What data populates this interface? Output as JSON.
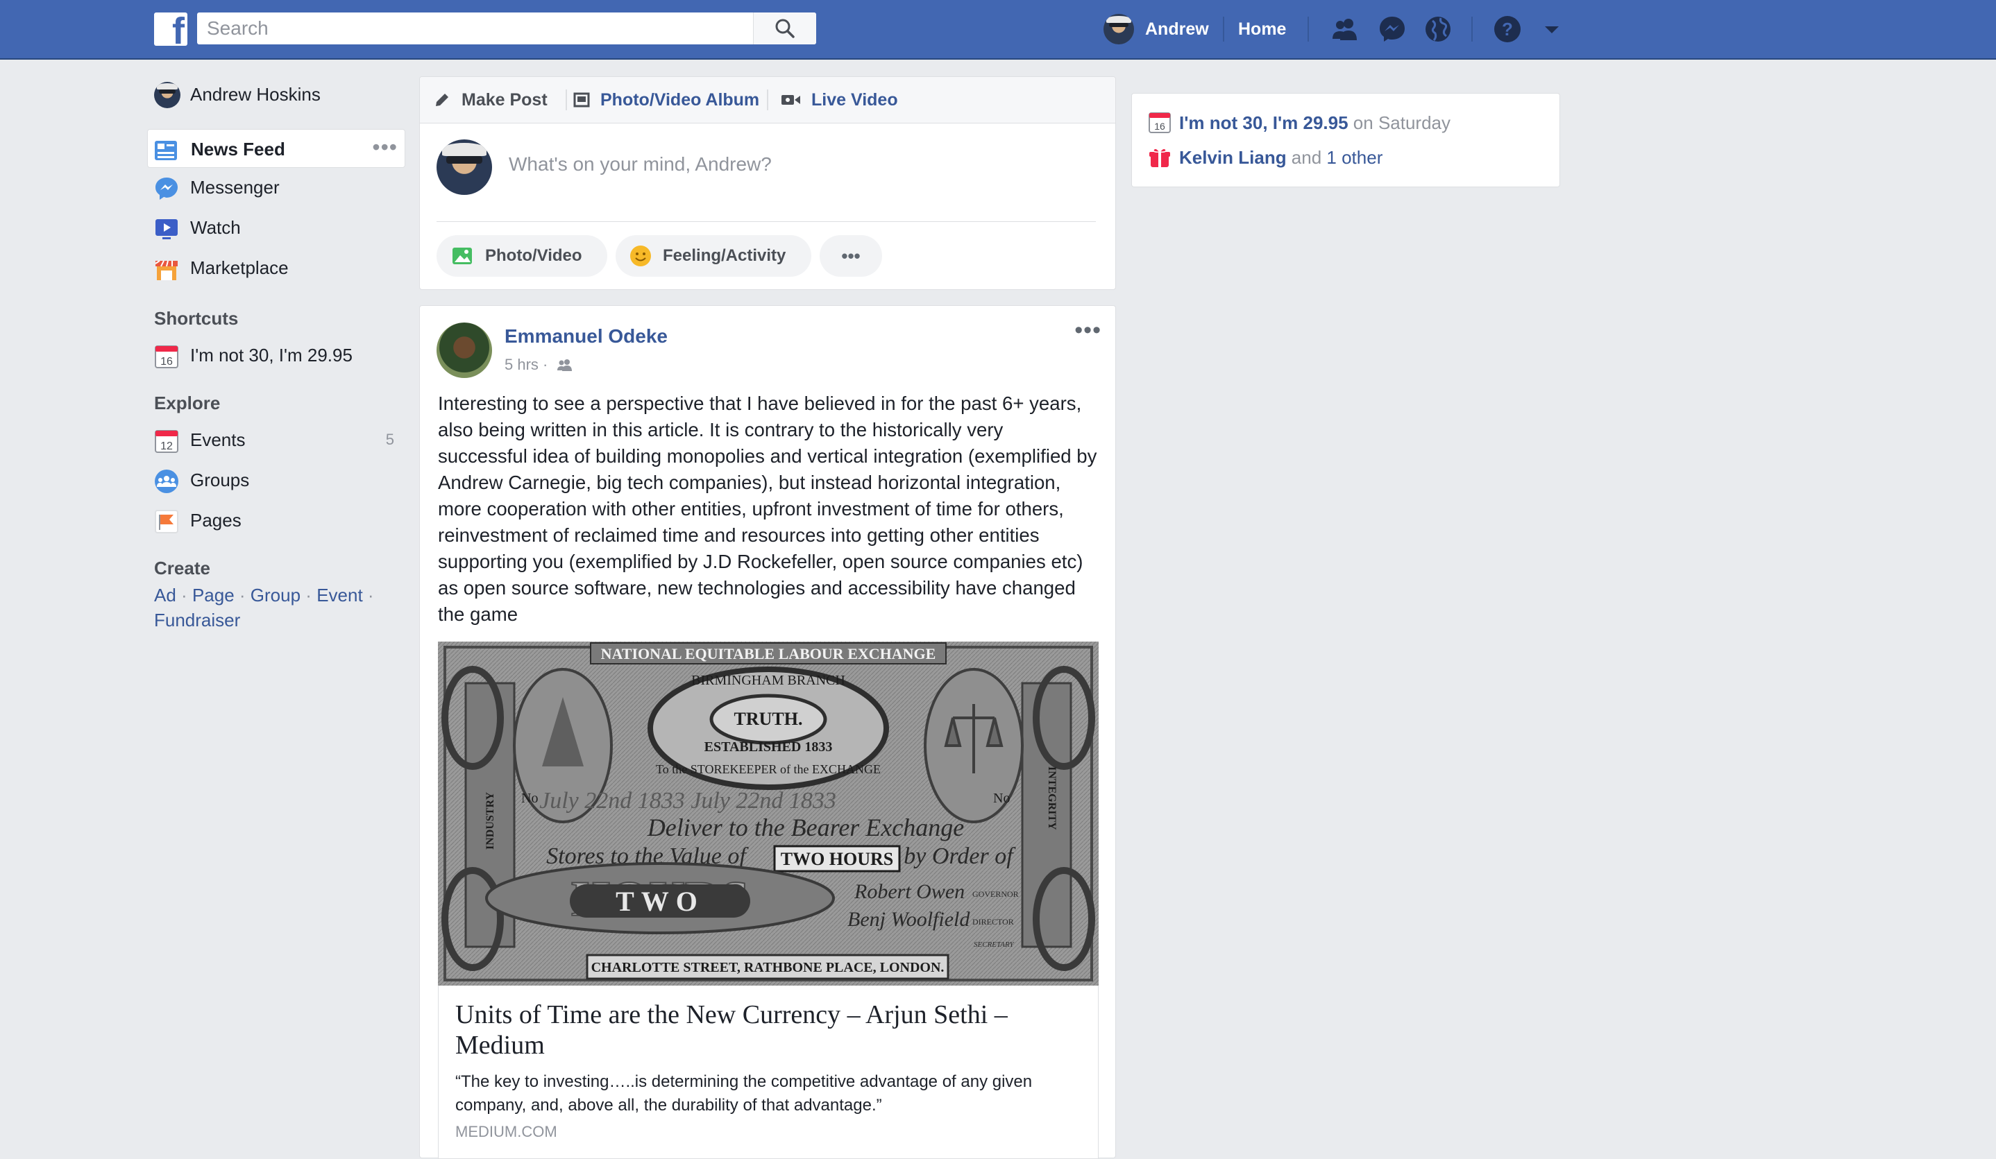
{
  "topbar": {
    "search_placeholder": "Search",
    "user_name": "Andrew",
    "home_label": "Home",
    "icons": [
      "friends-icon",
      "messenger-icon",
      "notifications-globe-icon",
      "help-icon",
      "account-menu-caret-icon"
    ]
  },
  "sidebar": {
    "profile_name": "Andrew Hoskins",
    "items": [
      {
        "label": "News Feed",
        "icon": "news-feed-icon",
        "active": true
      },
      {
        "label": "Messenger",
        "icon": "messenger-icon"
      },
      {
        "label": "Watch",
        "icon": "watch-icon"
      },
      {
        "label": "Marketplace",
        "icon": "marketplace-icon"
      }
    ],
    "shortcuts_title": "Shortcuts",
    "shortcuts": [
      {
        "label": "I'm not 30, I'm 29.95",
        "icon": "calendar-icon",
        "date": "16"
      }
    ],
    "explore_title": "Explore",
    "explore": [
      {
        "label": "Events",
        "icon": "calendar-icon",
        "date": "12",
        "count": "5"
      },
      {
        "label": "Groups",
        "icon": "groups-icon"
      },
      {
        "label": "Pages",
        "icon": "pages-flag-icon"
      }
    ],
    "create_title": "Create",
    "create_links": [
      "Ad",
      "Page",
      "Group",
      "Event",
      "Fundraiser"
    ]
  },
  "composer": {
    "tabs": [
      "Make Post",
      "Photo/Video Album",
      "Live Video"
    ],
    "placeholder": "What's on your mind, Andrew?",
    "actions": [
      "Photo/Video",
      "Feeling/Activity"
    ],
    "more_label": "•••"
  },
  "post": {
    "author": "Emmanuel Odeke",
    "time": "5 hrs ·",
    "text": "Interesting to see a perspective that I have believed in for the past 6+ years, also being written in this article. It is contrary to the historically very successful idea of building monopolies and vertical integration (exemplified by Andrew Carnegie, big tech companies), but instead horizontal integration, more cooperation with other entities, upfront investment of time for others, reinvestment of reclaimed time and resources into getting other entities supporting you (exemplified by J.D Rockefeller, open source companies etc) as open source software, new technologies and accessibility have changed the game",
    "image": {
      "top_text": "NATIONAL EQUITABLE LABOUR EXCHANGE",
      "branch_text": "BIRMINGHAM BRANCH",
      "truth_text": "TRUTH.",
      "established_text": "ESTABLISHED 1833",
      "storekeeper_text": "To the STOREKEEPER of the EXCHANGE",
      "date_text": "July 22nd 1833  July 22nd 1833",
      "deliver_text": "Deliver to the Bearer Exchange",
      "value_text_left": "Stores to the Value of",
      "two_hours_text": "TWO HOURS",
      "value_text_right": "by Order of",
      "two_text": "TWO",
      "hours_text": "HOURS",
      "signature1": "Robert Owen",
      "signature1_title": "GOVERNOR",
      "signature2": "Benj Woolfield",
      "signature2_title": "DIRECTOR",
      "secretary": "SECRETARY",
      "industry_text": "INDUSTRY",
      "integrity_text": "INTEGRITY",
      "no_left": "No",
      "no_right": "No",
      "bottom_text": "CHARLOTTE STREET, RATHBONE PLACE, LONDON."
    },
    "link": {
      "title": "Units of Time are the New Currency – Arjun Sethi – Medium",
      "description": "“The key to investing…..is determining the competitive advantage of any given company, and, above all, the durability of that advantage.”",
      "domain": "MEDIUM.COM"
    }
  },
  "reminders": {
    "event_name": "I'm not 30, I'm 29.95",
    "event_when": " on Saturday",
    "event_date": "16",
    "birthday_name": "Kelvin Liang",
    "birthday_and": " and ",
    "birthday_other": "1 other"
  },
  "colors": {
    "brand_blue": "#4267b2",
    "link_blue": "#385898",
    "background": "#e9ebee"
  }
}
